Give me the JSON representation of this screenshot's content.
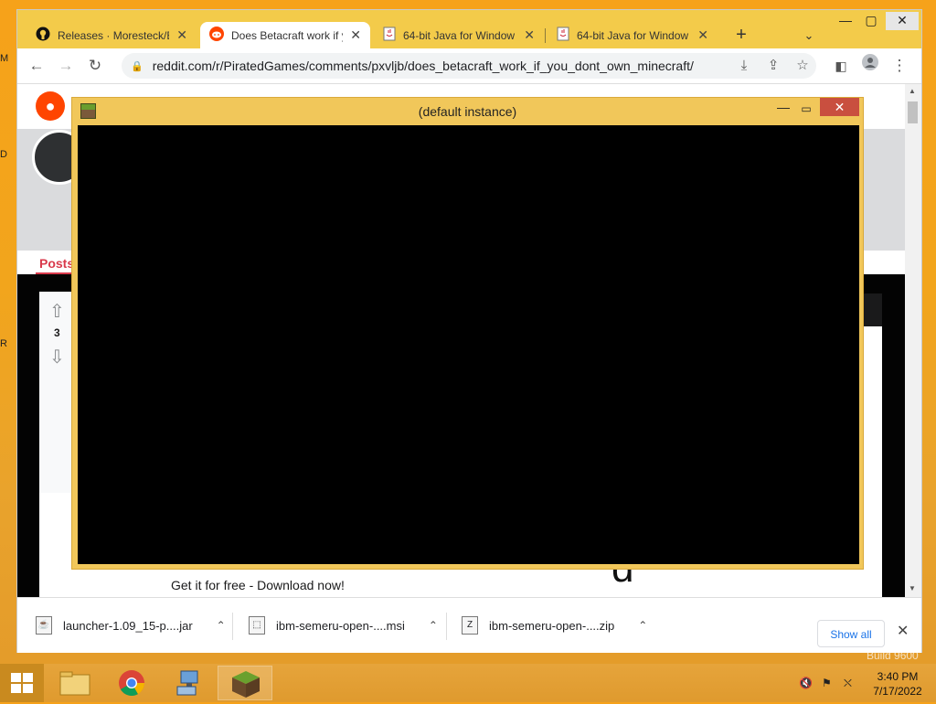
{
  "desktop": {
    "edge_labels": [
      "M",
      "D",
      "R"
    ],
    "watermark": "Build 9600"
  },
  "browser": {
    "tabs": [
      {
        "title": "Releases · Moresteck/Bc",
        "icon": "github-icon",
        "active": false
      },
      {
        "title": "Does Betacraft work if y",
        "icon": "reddit-icon",
        "active": true
      },
      {
        "title": "64-bit Java for Window",
        "icon": "java-icon",
        "active": false
      },
      {
        "title": "64-bit Java for Window",
        "icon": "java-icon",
        "active": false
      }
    ],
    "url": "reddit.com/r/PiratedGames/comments/pxvljb/does_betacraft_work_if_you_dont_own_minecraft/"
  },
  "reddit": {
    "posts_tab": "Posts",
    "vote_count": "3",
    "ad_text": "Get it for free - Download now!",
    "side_char": "d"
  },
  "downloads": {
    "items": [
      {
        "name": "launcher-1.09_15-p....jar",
        "icon": "jar-file-icon"
      },
      {
        "name": "ibm-semeru-open-....msi",
        "icon": "msi-file-icon"
      },
      {
        "name": "ibm-semeru-open-....zip",
        "icon": "zip-file-icon"
      }
    ],
    "show_all": "Show all"
  },
  "minecraft_window": {
    "title": "(default instance)"
  },
  "taskbar": {
    "time": "3:40 PM",
    "date": "7/17/2022"
  },
  "colors": {
    "accent_orange": "#f6a21a",
    "reddit_orange": "#ff4500",
    "close_red": "#c94f3f"
  }
}
